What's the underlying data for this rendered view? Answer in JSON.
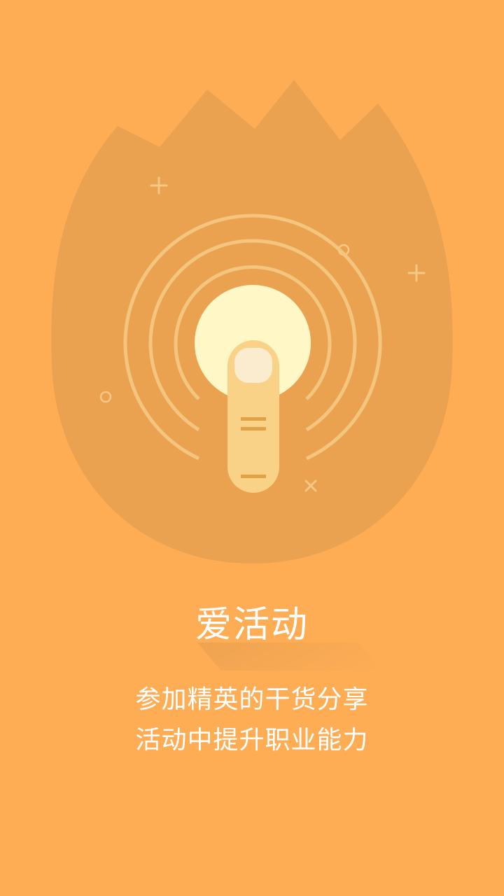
{
  "onboarding": {
    "title": "爱活动",
    "description_line1": "参加精英的干货分享",
    "description_line2": "活动中提升职业能力",
    "illustration": "finger-tap-icon"
  },
  "colors": {
    "background": "#FEAD55",
    "blob": "#EBA250",
    "ring": "#F3C57E",
    "glow": "#FFF8C6",
    "finger": "#F9D288",
    "nail": "#FBECD0",
    "lines": "#E0A245"
  }
}
